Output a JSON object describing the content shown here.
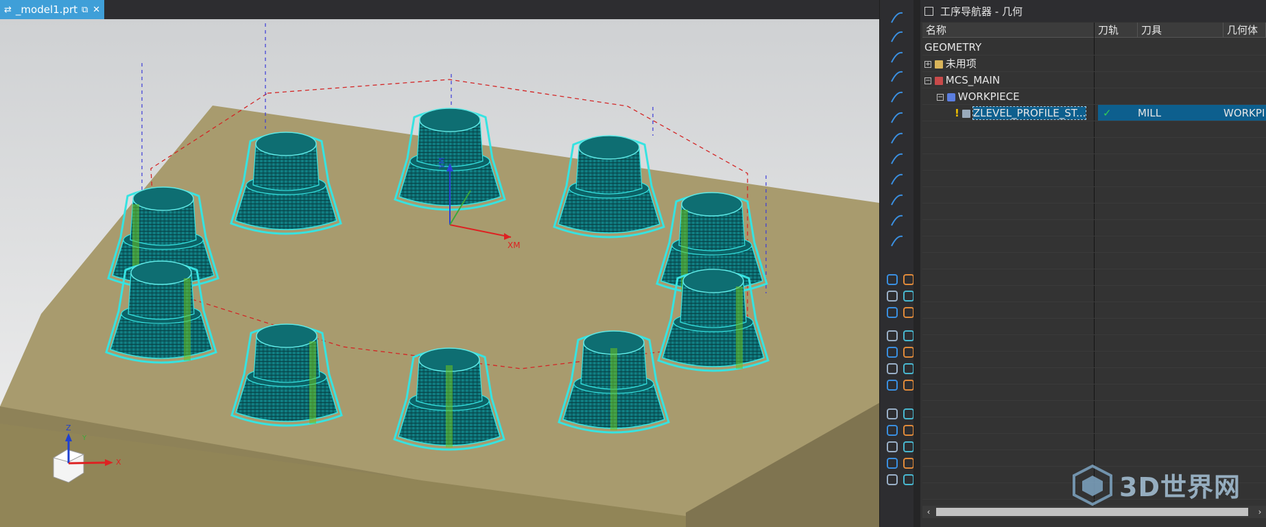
{
  "window": {
    "tab_title": "_model1.prt",
    "tab_icon": "part-file-icon",
    "tab_pin_glyph": "⧉",
    "tab_close_glyph": "✕"
  },
  "viewport": {
    "background_top": "#d9dbdc",
    "background_bottom": "#eeeeee",
    "plate_color": "#a89b6e",
    "part_color": "#0d6f73",
    "toolpath_color": "#36e3e1",
    "axis_label_xm": "XM",
    "axis_label_ym": "YM",
    "triad": {
      "x": "X",
      "y": "Y",
      "z": "Z"
    }
  },
  "navigator": {
    "title": "工序导航器 - 几何",
    "columns": [
      "名称",
      "刀轨",
      "刀具",
      "几何体"
    ],
    "rows": [
      {
        "name": "GEOMETRY",
        "toolpath": "",
        "tool": "",
        "geometry": "",
        "expander": "",
        "icon": ""
      },
      {
        "name": "未用项",
        "toolpath": "",
        "tool": "",
        "geometry": "",
        "expander": "+",
        "icon": "folder-icon"
      },
      {
        "name": "MCS_MAIN",
        "toolpath": "",
        "tool": "",
        "geometry": "",
        "expander": "−",
        "icon": "mcs-icon"
      },
      {
        "name": "WORKPIECE",
        "toolpath": "",
        "tool": "",
        "geometry": "",
        "expander": "−",
        "icon": "workpiece-icon"
      },
      {
        "name": "ZLEVEL_PROFILE_ST...",
        "toolpath": "✓",
        "tool": "MILL",
        "geometry": "WORKPI",
        "expander": "",
        "icon": "operation-icon",
        "status": "!"
      }
    ],
    "scroll_left": "‹",
    "scroll_right": "›"
  },
  "watermark": {
    "text": "3D世界网"
  },
  "colors": {
    "accent_tab": "#3f9fd8",
    "selection": "#0d5f8e",
    "check": "#33cc55",
    "warning": "#f0c000"
  }
}
